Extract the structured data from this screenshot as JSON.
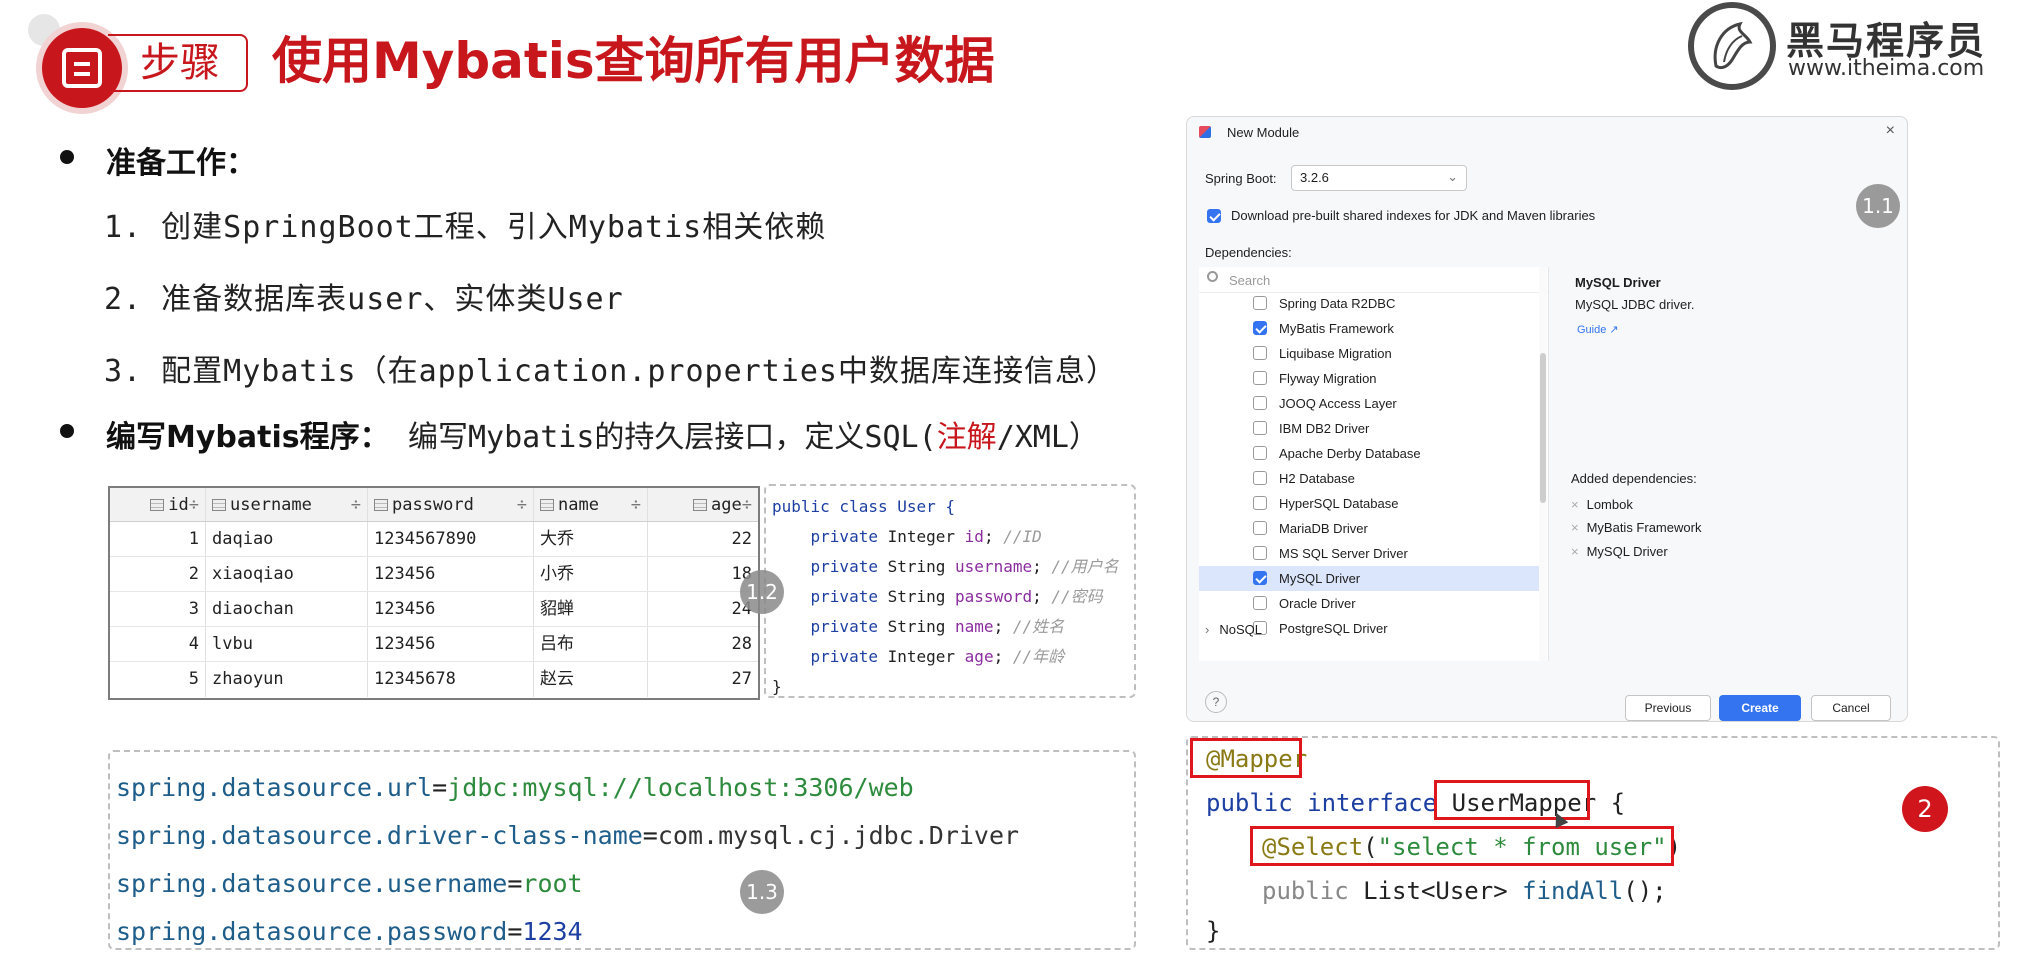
{
  "header": {
    "tag": "步骤",
    "title": "使用Mybatis查询所有用户数据",
    "logo_cn": "黑马程序员",
    "logo_url": "www.itheima.com"
  },
  "bullets": {
    "b1_title": "准备工作：",
    "steps": [
      "1. 创建SpringBoot工程、引入Mybatis相关依赖",
      "2. 准备数据库表user、实体类User",
      "3. 配置Mybatis（在application.properties中数据库连接信息）"
    ],
    "b2_title": "编写Mybatis程序：",
    "b2_desc_a": "编写Mybatis的持久层接口，定义SQL(",
    "b2_desc_red": "注解",
    "b2_desc_b": "/XML）"
  },
  "table": {
    "headers": [
      "id",
      "username",
      "password",
      "name",
      "age"
    ],
    "rows": [
      {
        "id": "1",
        "username": "daqiao",
        "password": "1234567890",
        "name": "大乔",
        "age": "22"
      },
      {
        "id": "2",
        "username": "xiaoqiao",
        "password": "123456",
        "name": "小乔",
        "age": "18"
      },
      {
        "id": "3",
        "username": "diaochan",
        "password": "123456",
        "name": "貂蝉",
        "age": "24"
      },
      {
        "id": "4",
        "username": "lvbu",
        "password": "123456",
        "name": "吕布",
        "age": "28"
      },
      {
        "id": "5",
        "username": "zhaoyun",
        "password": "12345678",
        "name": "赵云",
        "age": "27"
      }
    ]
  },
  "user_class": {
    "decl": "public class User {",
    "fields": [
      {
        "type": "Integer",
        "name": "id",
        "comment": "//ID"
      },
      {
        "type": "String",
        "name": "username",
        "comment": "//用户名"
      },
      {
        "type": "String",
        "name": "password",
        "comment": "//密码"
      },
      {
        "type": "String",
        "name": "name",
        "comment": "//姓名"
      },
      {
        "type": "Integer",
        "name": "age",
        "comment": "//年龄"
      }
    ],
    "close": "}"
  },
  "props": [
    {
      "key": "spring.datasource.url",
      "value": "jdbc:mysql://localhost:3306/web"
    },
    {
      "key": "spring.datasource.driver-class-name",
      "value": "com.mysql.cj.jdbc.Driver"
    },
    {
      "key": "spring.datasource.username",
      "value": "root"
    },
    {
      "key": "spring.datasource.password",
      "value": "1234"
    }
  ],
  "badges": {
    "b11": "1.1",
    "b12": "1.2",
    "b13": "1.3",
    "b2": "2"
  },
  "dialog": {
    "title": "New Module",
    "spring_boot_label": "Spring Boot:",
    "spring_boot_version": "3.2.6",
    "download_label": "Download pre-built shared indexes for JDK and Maven libraries",
    "dependencies_label": "Dependencies:",
    "search_placeholder": "Search",
    "items": [
      {
        "label": "Spring Data R2DBC",
        "checked": false
      },
      {
        "label": "MyBatis Framework",
        "checked": true
      },
      {
        "label": "Liquibase Migration",
        "checked": false
      },
      {
        "label": "Flyway Migration",
        "checked": false
      },
      {
        "label": "JOOQ Access Layer",
        "checked": false
      },
      {
        "label": "IBM DB2 Driver",
        "checked": false
      },
      {
        "label": "Apache Derby Database",
        "checked": false
      },
      {
        "label": "H2 Database",
        "checked": false
      },
      {
        "label": "HyperSQL Database",
        "checked": false
      },
      {
        "label": "MariaDB Driver",
        "checked": false
      },
      {
        "label": "MS SQL Server Driver",
        "checked": false
      },
      {
        "label": "MySQL Driver",
        "checked": true,
        "selected": true
      },
      {
        "label": "Oracle Driver",
        "checked": false
      },
      {
        "label": "PostgreSQL Driver",
        "checked": false
      }
    ],
    "nosql": "NoSQL",
    "info_title": "MySQL Driver",
    "info_desc": "MySQL JDBC driver.",
    "guide": "Guide ↗",
    "added_label": "Added dependencies:",
    "added": [
      "Lombok",
      "MyBatis Framework",
      "MySQL Driver"
    ],
    "btn_prev": "Previous",
    "btn_create": "Create",
    "btn_cancel": "Cancel",
    "help": "?"
  },
  "mapper": {
    "annotation": "@Mapper",
    "kw_public": "public",
    "kw_interface": "interface",
    "name": "UserMapper",
    "brace_open": "{",
    "select_ann": "@Select",
    "select_args_open": "(",
    "select_sql": "\"select * from user\"",
    "select_args_close": ")",
    "method_kw": "public",
    "method_ret": "List<User>",
    "method_name": "findAll",
    "method_tail": "();",
    "brace_close": "}"
  },
  "colors": {
    "brand_red": "#c8161d",
    "ide_blue": "#3574f0"
  }
}
